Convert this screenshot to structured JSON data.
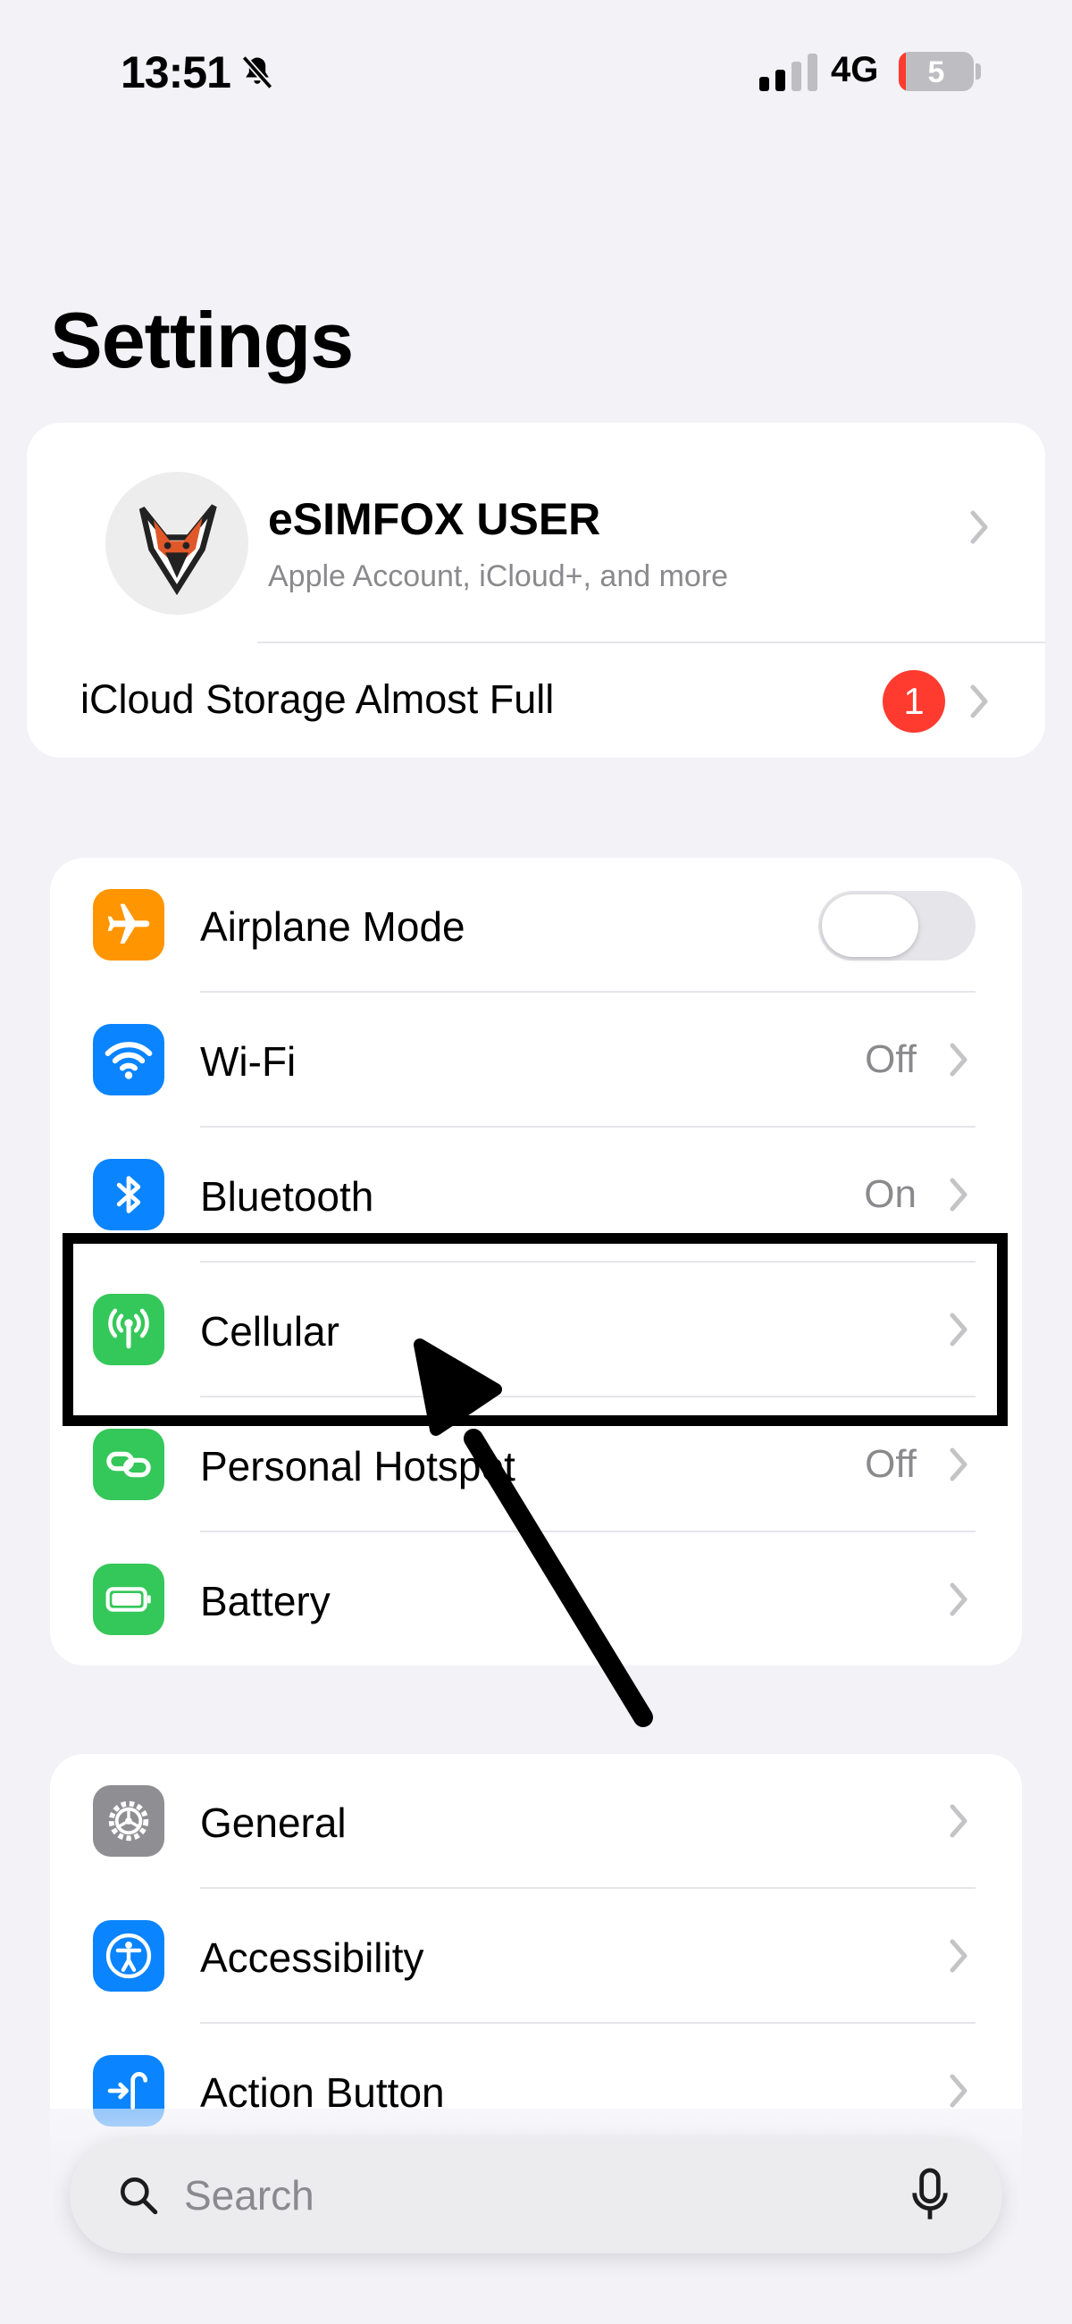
{
  "status_bar": {
    "time": "13:51",
    "network": "4G",
    "battery_level": "5",
    "icons": [
      "silent-bell-icon",
      "signal-icon",
      "battery-icon"
    ]
  },
  "page_title": "Settings",
  "account": {
    "name": "eSIMFOX USER",
    "subtitle": "Apple Account, iCloud+, and more",
    "storage_label": "iCloud Storage Almost Full",
    "storage_badge": "1"
  },
  "group1": [
    {
      "label": "Airplane Mode",
      "icon": "airplane-icon",
      "color": "#ff9500",
      "toggle": false
    },
    {
      "label": "Wi-Fi",
      "value": "Off",
      "icon": "wifi-icon",
      "color": "#0a84ff"
    },
    {
      "label": "Bluetooth",
      "value": "On",
      "icon": "bluetooth-icon",
      "color": "#0a84ff"
    },
    {
      "label": "Cellular",
      "value": "",
      "icon": "antenna-icon",
      "color": "#34c759"
    },
    {
      "label": "Personal Hotspot",
      "value": "Off",
      "icon": "hotspot-icon",
      "color": "#34c759"
    },
    {
      "label": "Battery",
      "value": "",
      "icon": "battery-icon",
      "color": "#34c759"
    }
  ],
  "group2": [
    {
      "label": "General",
      "icon": "gear-icon",
      "color": "#8e8e93"
    },
    {
      "label": "Accessibility",
      "icon": "accessibility-icon",
      "color": "#0a84ff"
    },
    {
      "label": "Action Button",
      "icon": "action-button-icon",
      "color": "#0a84ff"
    }
  ],
  "search": {
    "placeholder": "Search"
  },
  "colors": {
    "background": "#f2f2f7",
    "badge": "#ff3b30",
    "annotation": "#000000"
  }
}
